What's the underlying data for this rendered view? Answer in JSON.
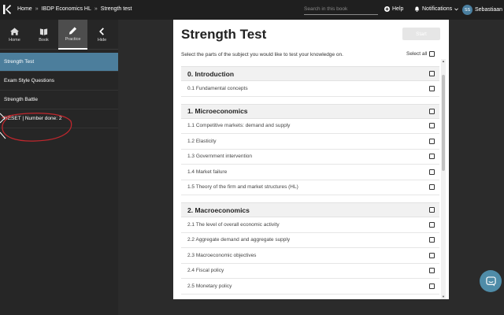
{
  "topbar": {
    "breadcrumb": [
      "Home",
      "IBDP Economics HL",
      "Strength test"
    ],
    "breadcrumb_sep": "»",
    "search_placeholder": "Search in this book",
    "help_label": "Help",
    "notifications_label": "Notifications",
    "user_initials": "SS",
    "user_name": "Sebastiaan"
  },
  "sidebar": {
    "nav": [
      {
        "label": "Home",
        "icon": "home-icon"
      },
      {
        "label": "Book",
        "icon": "book-icon"
      },
      {
        "label": "Practice",
        "icon": "pencil-icon",
        "active": true
      },
      {
        "label": "Hide",
        "icon": "chevron-left-icon"
      }
    ],
    "items": [
      {
        "label": "Strength Test",
        "active": true
      },
      {
        "label": "Exam Style Questions"
      },
      {
        "label": "Strength Battle"
      },
      {
        "label": "RESET | Number done: 2"
      }
    ]
  },
  "main": {
    "title": "Strength Test",
    "start_label": "Start",
    "intro": "Select the parts of the subject you would like to test your knowledge on.",
    "select_all_label": "Select all",
    "sections": [
      {
        "title": "0. Introduction",
        "items": [
          "0.1 Fundamental concepts"
        ]
      },
      {
        "title": "1. Microeconomics",
        "items": [
          "1.1 Competitive markets: demand and supply",
          "1.2 Elasticity",
          "1.3 Government intervention",
          "1.4 Market failure",
          "1.5 Theory of the firm and market structures (HL)"
        ]
      },
      {
        "title": "2. Macroeconomics",
        "items": [
          "2.1 The level of overall economic activity",
          "2.2 Aggregate demand and aggregate supply",
          "2.3 Macroeconomic objectives",
          "2.4 Fiscal policy",
          "2.5 Monetary policy"
        ]
      }
    ]
  },
  "colors": {
    "accent": "#4c7e9c",
    "annotation": "#c0262d",
    "chat": "#4f8ca8"
  }
}
